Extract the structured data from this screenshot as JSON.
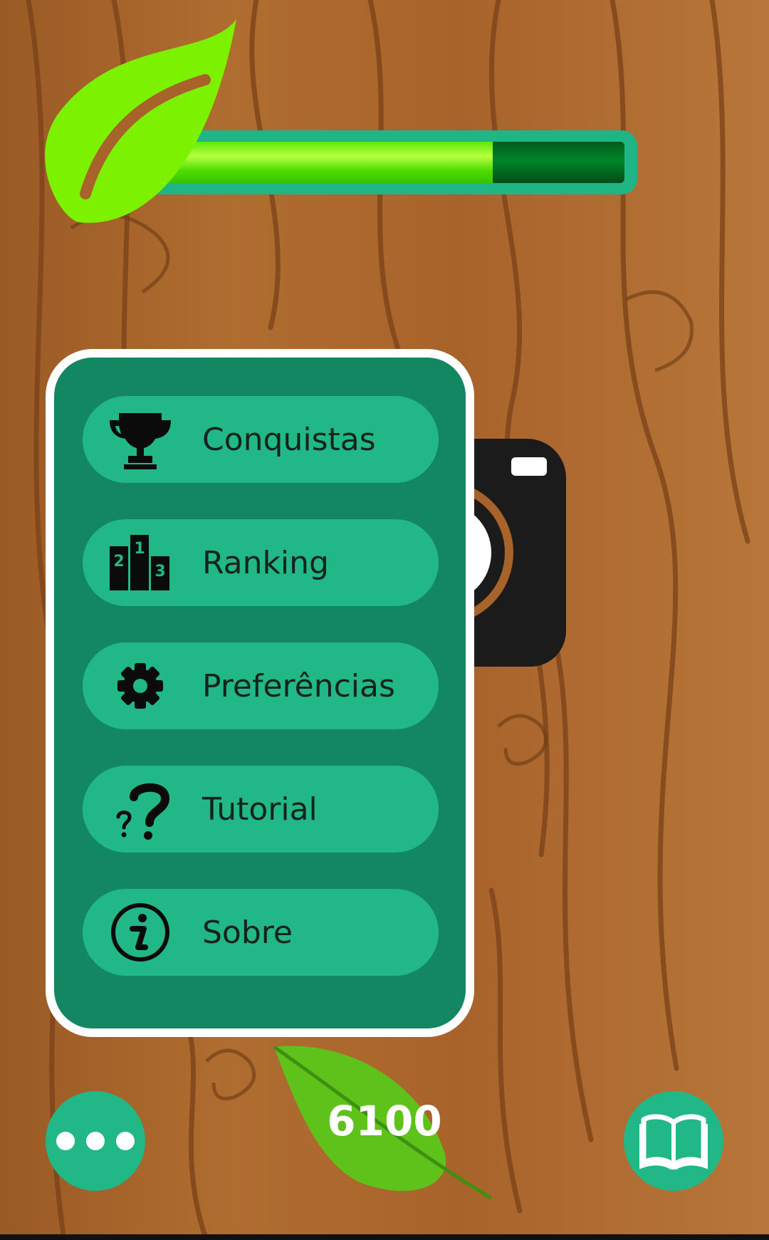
{
  "progress": {
    "fraction": 0.72
  },
  "menu": {
    "items": [
      {
        "label": "Conquistas",
        "icon": "trophy-icon"
      },
      {
        "label": "Ranking",
        "icon": "podium-icon"
      },
      {
        "label": "Preferências",
        "icon": "gear-icon"
      },
      {
        "label": "Tutorial",
        "icon": "question-icon"
      },
      {
        "label": "Sobre",
        "icon": "info-icon"
      }
    ]
  },
  "podium": {
    "first": "1",
    "second": "2",
    "third": "3"
  },
  "score": "6100",
  "colors": {
    "menu_bg": "#138761",
    "menu_item": "#21b786",
    "leaf": "#7cf200",
    "wood": "#a8632a"
  },
  "bottom": {
    "more_icon": "more-dots-icon",
    "book_icon": "book-icon"
  }
}
